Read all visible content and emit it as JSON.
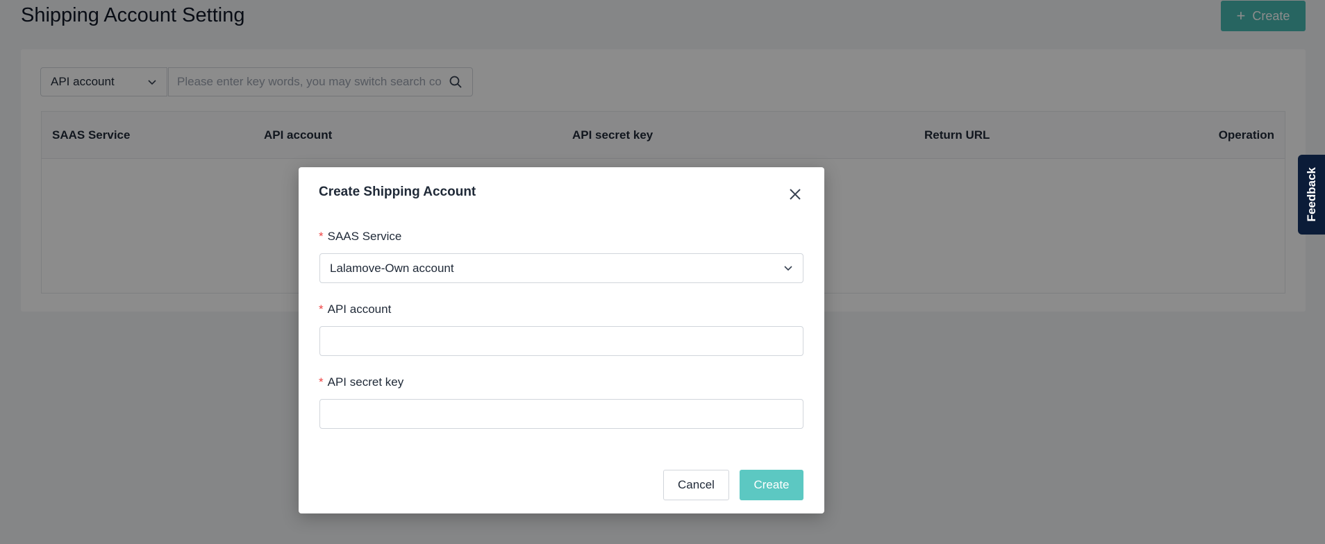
{
  "page": {
    "title": "Shipping Account Setting",
    "create_label": "Create"
  },
  "filter": {
    "field_selected": "API account",
    "search_placeholder": "Please enter key words, you may switch search co"
  },
  "table": {
    "columns": [
      "SAAS Service",
      "API account",
      "API secret key",
      "Return URL",
      "Operation"
    ]
  },
  "feedback": {
    "label": "Feedback"
  },
  "modal": {
    "title": "Create Shipping Account",
    "fields": {
      "saas_service": {
        "label": "SAAS Service",
        "value": "Lalamove-Own account",
        "required_mark": "*"
      },
      "api_account": {
        "label": "API account",
        "value": "",
        "required_mark": "*"
      },
      "api_secret_key": {
        "label": "API secret key",
        "value": "",
        "required_mark": "*"
      }
    },
    "cancel_label": "Cancel",
    "create_label": "Create"
  },
  "colors": {
    "accent": "#47b8b1",
    "accent_light": "#5cc8c2",
    "feedback_bg": "#0b1c38",
    "required": "#ef4444"
  }
}
